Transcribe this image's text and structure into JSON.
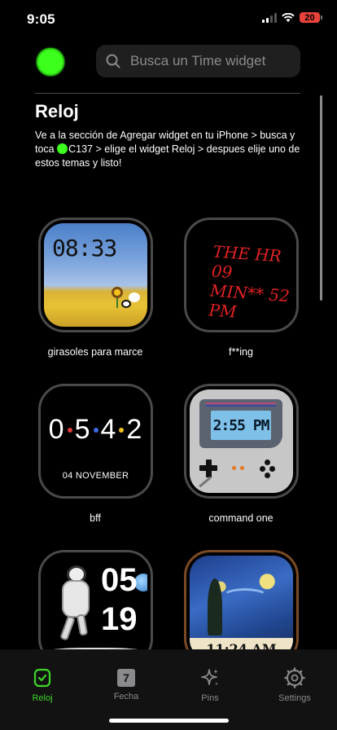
{
  "status": {
    "time": "9:05",
    "battery": "20",
    "icons": [
      "cellular-signal-icon",
      "wifi-icon",
      "battery-icon"
    ]
  },
  "header": {
    "avatar_color": "#3cff1e",
    "search_placeholder": "Busca un Time widget"
  },
  "section": {
    "title": "Reloj",
    "description_part1": "Ve a la sección de Agregar widget en tu iPhone > busca y toca ",
    "description_part2": "C137 > elige el widget Reloj > despues elije uno de estos temas y listo!"
  },
  "widgets": [
    {
      "label": "girasoles para marce",
      "display_time": "08:33"
    },
    {
      "label": "f**ing",
      "display_lines": [
        "THE HR 09",
        "MIN** 52",
        "PM"
      ]
    },
    {
      "label": "bff",
      "digits": [
        "0",
        "5",
        "4",
        "2"
      ],
      "date": "04 NOVEMBER",
      "dot_colors": [
        "#e23b3b",
        "#3b6be2",
        "#f2c21b"
      ]
    },
    {
      "label": "command one",
      "display_time": "2:55 PM"
    },
    {
      "label": "",
      "hour": "05",
      "minute": "19"
    },
    {
      "label": "",
      "display_time": "11:24 AM"
    }
  ],
  "tabs": [
    {
      "label": "Reloj",
      "icon": "watch-icon",
      "active": true
    },
    {
      "label": "Fecha",
      "icon": "calendar-icon",
      "badge": "7",
      "active": false
    },
    {
      "label": "Pins",
      "icon": "sparkles-icon",
      "active": false
    },
    {
      "label": "Settings",
      "icon": "gear-icon",
      "active": false
    }
  ],
  "colors": {
    "accent": "#3cd628",
    "background": "#000000",
    "battery_low": "#e8433a"
  }
}
